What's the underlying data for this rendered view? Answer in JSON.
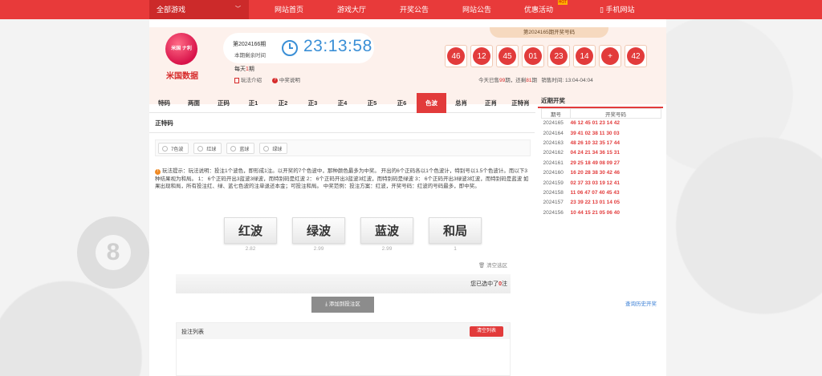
{
  "nav": {
    "game_select": "全部游戏",
    "items": [
      "网站首页",
      "游戏大厅",
      "开奖公告",
      "网站公告",
      "优惠活动",
      "手机网站"
    ],
    "hot_badge": "HOT"
  },
  "header": {
    "logo_text": "米国数据",
    "logo_badge": "米国 ナ利",
    "period": "第2024166期",
    "remain_label": "本期剩余时间",
    "timer": "23:13:58",
    "today_prefix": "每天",
    "today_count": "1",
    "today_suffix": "期",
    "rules_link": "玩法介绍",
    "winners_link": "中奖说明"
  },
  "draw": {
    "title": "第2024165期开奖号码",
    "numbers": [
      "46",
      "12",
      "45",
      "01",
      "23",
      "14",
      "+",
      "42"
    ],
    "sold_prefix": "今天已售",
    "sold_count": "99",
    "sold_mid": "期，还剩",
    "remaining_count": "81",
    "sold_suffix": "期",
    "sale_time": "销售时间: 13:04-04:04"
  },
  "tabs": {
    "row1": [
      "特码",
      "两面",
      "正码",
      "正1",
      "正2",
      "正3",
      "正4",
      "正5",
      "正6",
      "色波",
      "总肖",
      "正肖",
      "正特肖"
    ],
    "row2": [
      "正特码"
    ],
    "active": "色波"
  },
  "options": [
    "7色波",
    "红球",
    "蓝球",
    "绿球"
  ],
  "tip": "玩法提示：玩法说明：投注1个波色，即形成1注。以开奖的7个色波中，那种颜色最多为中奖。 开出的6个正码各以1个色波计，特别号以1.5个色波计。而以下3种结果视为和局。 1： 6个正码开出3蓝波3绿波，而特别码是红波 2： 6个正码开出3蓝波3红波，而特别码是绿波 3： 6个正码开出3绿波3红波，而特别码是蓝波 如果出现和局，所有投注红、绿、蓝七色波的注单退还本金；可投注和局。 中奖范例：投注方案：红波，开奖号码：红波的号码最多，即中奖。",
  "bets": [
    {
      "label": "红波",
      "odds": "2.82"
    },
    {
      "label": "绿波",
      "odds": "2.99"
    },
    {
      "label": "蓝波",
      "odds": "2.99"
    },
    {
      "label": "和局",
      "odds": "1"
    }
  ],
  "selection": {
    "clear_label": "清空选区",
    "selected_prefix": "您已选中了",
    "selected_count": "0",
    "selected_suffix": "注",
    "add_button": "添加到投注区"
  },
  "bet_list": {
    "title": "投注列表",
    "clear_button": "清空列表"
  },
  "recent": {
    "title": "近期开奖",
    "col_period": "期号",
    "col_numbers": "开奖号码",
    "rows": [
      {
        "period": "2024165",
        "numbers": "46 12 45 01 23 14 42"
      },
      {
        "period": "2024164",
        "numbers": "39 41 02 38 11 30 03"
      },
      {
        "period": "2024163",
        "numbers": "48 26 10 32 35 17 44"
      },
      {
        "period": "2024162",
        "numbers": "04 24 21 34 36 15 31"
      },
      {
        "period": "2024161",
        "numbers": "29 25 18 49 08 09 27"
      },
      {
        "period": "2024160",
        "numbers": "16 20 28 38 30 42 46"
      },
      {
        "period": "2024159",
        "numbers": "02 37 33 03 19 12 41"
      },
      {
        "period": "2024158",
        "numbers": "11 06 47 07 40 45 43"
      },
      {
        "period": "2024157",
        "numbers": "23 39 22 13 01 14 05"
      },
      {
        "period": "2024156",
        "numbers": "10 44 15 21 05 06 40"
      }
    ],
    "history_link": "查询历史开奖"
  },
  "colors": {
    "brand": "#e83a3a",
    "timer": "#3a8fd6",
    "link": "#3a7fd6"
  }
}
